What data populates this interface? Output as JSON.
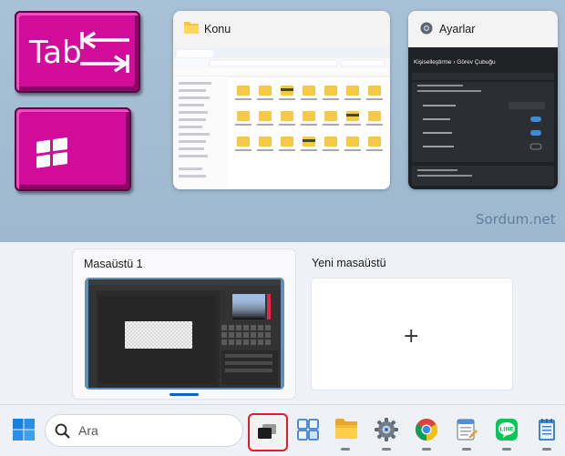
{
  "keys": {
    "tab_label": "Tab"
  },
  "windows": [
    {
      "title": "Konu",
      "icon": "folder-icon"
    },
    {
      "title": "Ayarlar",
      "icon": "settings-gear-icon"
    }
  ],
  "ayarlar_thumb": {
    "breadcrumb": "Kişiselleştirme  ›  Görev Çubuğu"
  },
  "watermark": "Sordum.net",
  "desktops": [
    {
      "label": "Masaüstü 1"
    },
    {
      "label": "Yeni masaüstü"
    }
  ],
  "new_desktop_plus": "+",
  "taskbar": {
    "search_placeholder": "Ara",
    "pinned": [
      "start-icon",
      "search",
      "task-view",
      "widgets",
      "file-explorer",
      "settings",
      "chrome",
      "notepad",
      "line",
      "notes"
    ]
  },
  "colors": {
    "key_magenta": "#d10c9a",
    "highlight_red": "#e41c22",
    "accent_blue": "#0a64c8"
  }
}
